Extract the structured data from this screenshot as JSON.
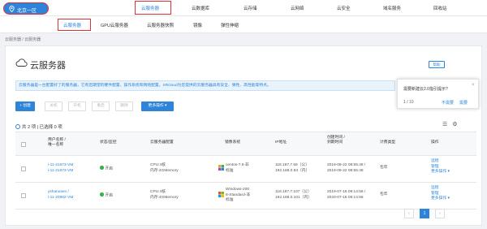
{
  "top_nav": {
    "region": "北京一区",
    "items": [
      "云服务器",
      "云数据库",
      "云存储",
      "云网络",
      "云安全",
      "域名服务",
      "回收站"
    ]
  },
  "sub_nav": {
    "items": [
      "云服务器",
      "GPU云服务器",
      "云服务器快照",
      "镜像",
      "弹性伸缩"
    ]
  },
  "breadcrumb": "云服务器 / 云服务器",
  "page": {
    "title": "云服务器",
    "help": "帮助",
    "info": "云服务器是一台配置好了的服务器，它有您期望的硬件配置、操作系统和网络配置。XRcloud为您提供的云服务器具有安全、弹性、高性能等特点。"
  },
  "popup": {
    "question": "需要新建云2.0指引提示?",
    "page": "1 / 10",
    "no": "不需要",
    "yes": "需要",
    "close": "×"
  },
  "toolbar": {
    "create": "+ 创建",
    "shutdown": "关机",
    "start": "开机",
    "restart": "重启",
    "delete": "删除",
    "more": "更多操作 ▾"
  },
  "summary": "共 2 项 | 已选择 0 项",
  "table": {
    "headers": {
      "name": [
        "用户名称 /",
        "唯一名称"
      ],
      "status": "状态/监控",
      "config": "云服务器配置",
      "os": "镜像系统",
      "ip": "IP地址",
      "time": [
        "创建时间 /",
        "到期时间"
      ],
      "billing": "计费类型",
      "ops": "操作"
    },
    "rows": [
      {
        "name": "i-11-21673-VM",
        "id": "i-11-21673-VM",
        "status": "开启",
        "cpu": "CPU:4核",
        "mem": "内存:4GMemory",
        "os": [
          "centos-7.6-非",
          "标准"
        ],
        "ip1": "118.187.7.59（公）",
        "ip2": "192.168.0.93（内）",
        "created": "2019-08-22 08:55:48 /",
        "expires": "2019-09-22 08:55:48",
        "billing": "包年",
        "ops": [
          "远程",
          "管理",
          "更多操作 ▾"
        ]
      },
      {
        "name": "yshanusen /",
        "id": "i-11-20982-VM",
        "status": "开启",
        "cpu": "CPU:4核",
        "mem": "内存:4GMemory",
        "os": [
          "Windows-200",
          "8-Standard-非",
          "标准"
        ],
        "ip1": "118.187.7.107（公）",
        "ip2": "192.168.0.101（内）",
        "created": "2019-07-16 09:14:56 /",
        "expires": "2020-07-16 09:14:56",
        "billing": "包年",
        "ops": [
          "远程",
          "管理",
          "更多操作 ▾"
        ]
      }
    ]
  },
  "pagination": {
    "prev": "‹",
    "current": "1",
    "next": "›"
  },
  "colors": {
    "accent": "#2d84d8",
    "highlight": "#e0303a",
    "status_on": "#3db04b"
  },
  "icons": [
    "map-pin-icon",
    "cloud-icon",
    "list-view-icon",
    "settings-icon",
    "info-icon",
    "centos-icon",
    "windows-icon"
  ]
}
